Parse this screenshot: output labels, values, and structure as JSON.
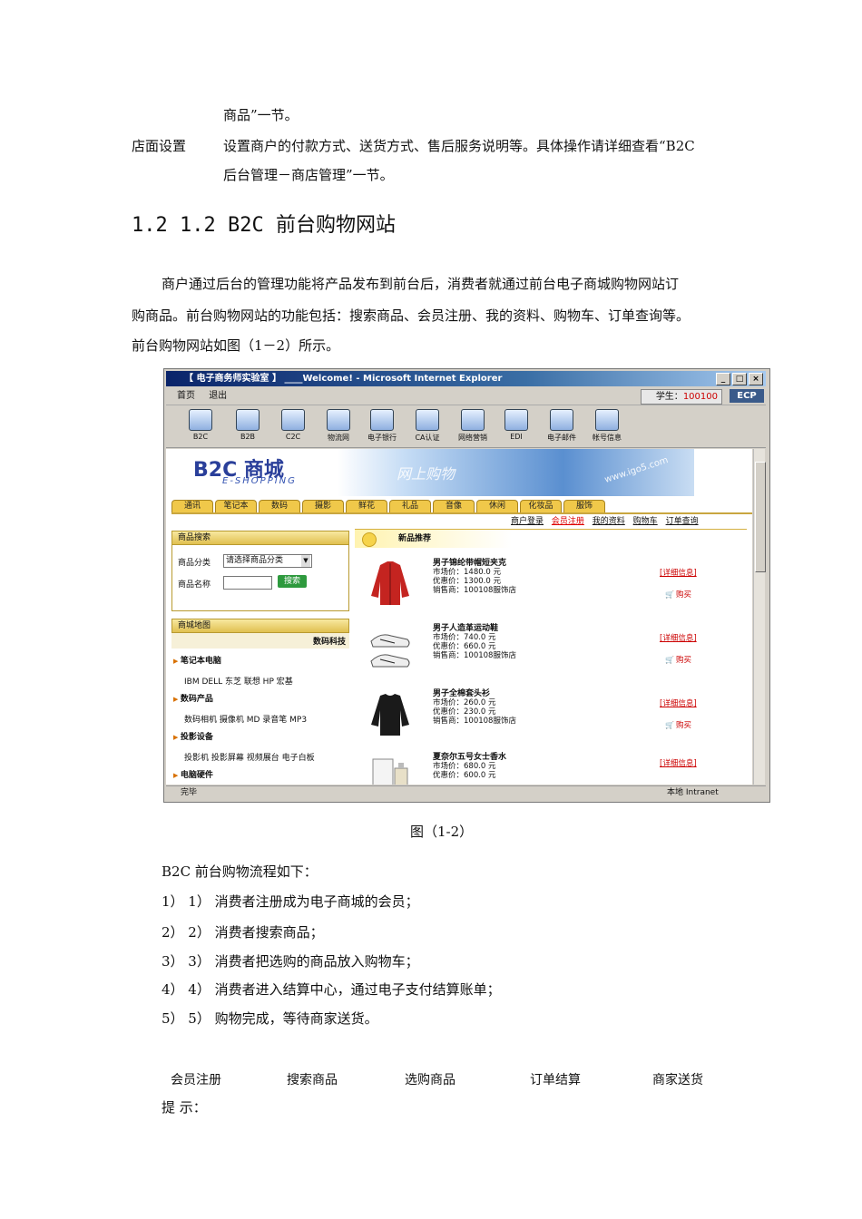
{
  "intro": {
    "line1": "商品”一节。",
    "label": "店面设置",
    "line2": "设置商户的付款方式、送货方式、售后服务说明等。具体操作请详细查看“B2C",
    "line3": "后台管理－商店管理”一节。"
  },
  "heading": "1.2 1.2 B2C 前台购物网站",
  "paragraph": [
    "商户通过后台的管理功能将产品发布到前台后，消费者就通过前台电子商城购物网站订",
    "购商品。前台购物网站的功能包括：搜索商品、会员注册、我的资料、购物车、订单查询等。",
    "前台购物网站如图（1－2）所示。"
  ],
  "screenshot": {
    "window_title": "【 电子商务师实验室 】 ____Welcome! - Microsoft Internet Explorer",
    "window_buttons": [
      "_",
      "□",
      "×"
    ],
    "menu": [
      "首页",
      "退出"
    ],
    "student_label": "学生：",
    "student_id": "100100",
    "ecp": "ECP",
    "tools": [
      "B2C",
      "B2B",
      "C2C",
      "物流网",
      "电子银行",
      "CA认证",
      "网络营销",
      "EDI",
      "电子邮件",
      "帐号信息"
    ],
    "logo": "B2C 商城",
    "logo_sub": "E-SHOPPING",
    "banner_slogan": "网上购物",
    "banner_url": "www.igo5.com",
    "categories": [
      "通讯",
      "笔记本",
      "数码",
      "摄影",
      "鲜花",
      "礼品",
      "音像",
      "休闲",
      "化妆品",
      "服饰"
    ],
    "user_links": [
      "商户登录",
      "会员注册",
      "我的资料",
      "购物车",
      "订单查询"
    ],
    "search": {
      "title": "商品搜索",
      "category_label": "商品分类",
      "category_value": "请选择商品分类",
      "name_label": "商品名称",
      "button": "搜索"
    },
    "map": {
      "title": "商城地图",
      "sub": "数码科技",
      "sections": [
        {
          "head": "笔记本电脑",
          "links": "IBM  DELL  东芝  联想  HP  宏基"
        },
        {
          "head": "数码产品",
          "links": "数码相机  摄像机  MD  录音笔  MP3"
        },
        {
          "head": "投影设备",
          "links": "投影机  投影屏幕  视频展台  电子白板"
        },
        {
          "head": "电脑硬件",
          "links": ""
        }
      ]
    },
    "new_title": "新品推荐",
    "products": [
      {
        "name": "男子锦纶带帽短夹克",
        "market": "市场价：1480.0 元",
        "sale": "优惠价：1300.0 元",
        "seller": "销售商：100108服饰店"
      },
      {
        "name": "男子人造革运动鞋",
        "market": "市场价：740.0 元",
        "sale": "优惠价：660.0 元",
        "seller": "销售商：100108服饰店"
      },
      {
        "name": "男子全棉套头衫",
        "market": "市场价：260.0 元",
        "sale": "优惠价：230.0 元",
        "seller": "销售商：100108服饰店"
      },
      {
        "name": "夏奈尔五号女士香水",
        "market": "市场价：680.0 元",
        "sale": "优惠价：600.0 元",
        "seller": ""
      }
    ],
    "detail_link": "[详细信息]",
    "buy_link": "购买",
    "status_done": "完毕",
    "status_zone": "本地 Intranet"
  },
  "caption": "图（1-2）",
  "flow_title": "B2C 前台购物流程如下：",
  "steps": [
    "1） 1）  消费者注册成为电子商城的会员；",
    "2） 2）  消费者搜索商品；",
    "3） 3）  消费者把选购的商品放入购物车；",
    "4） 4）  消费者进入结算中心，通过电子支付结算账单；",
    "5） 5）  购物完成，等待商家送货。"
  ],
  "flow": [
    "会员注册",
    "搜索商品",
    "选购商品",
    "订单结算",
    "商家送货"
  ],
  "hint": "提 示："
}
